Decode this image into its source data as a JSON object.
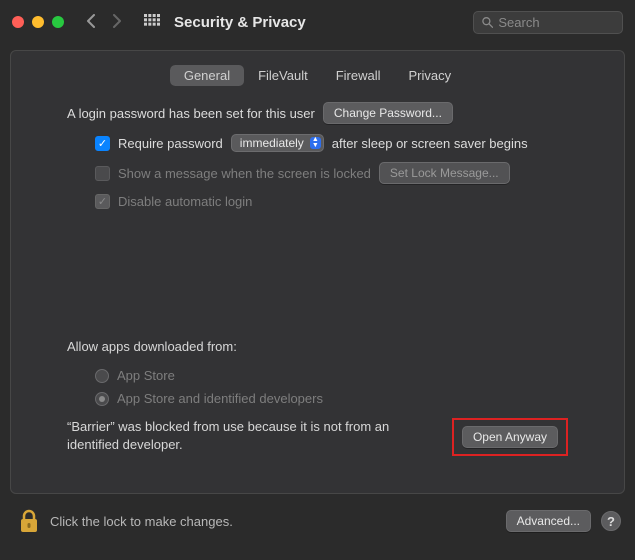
{
  "header": {
    "title": "Security & Privacy",
    "search_placeholder": "Search"
  },
  "tabs": {
    "items": [
      "General",
      "FileVault",
      "Firewall",
      "Privacy"
    ],
    "active_index": 0
  },
  "general": {
    "login_pw_set": "A login password has been set for this user",
    "change_password": "Change Password...",
    "require_password_pre": "Require password",
    "require_password_delay": "immediately",
    "require_password_post": "after sleep or screen saver begins",
    "show_message": "Show a message when the screen is locked",
    "set_lock_message": "Set Lock Message...",
    "disable_auto_login": "Disable automatic login"
  },
  "allow_apps": {
    "heading": "Allow apps downloaded from:",
    "options": [
      "App Store",
      "App Store and identified developers"
    ],
    "selected_index": 1,
    "blocked_message": "“Barrier” was blocked from use because it is not from an identified developer.",
    "open_anyway": "Open Anyway"
  },
  "footer": {
    "lock_text": "Click the lock to make changes.",
    "advanced": "Advanced...",
    "help": "?"
  }
}
